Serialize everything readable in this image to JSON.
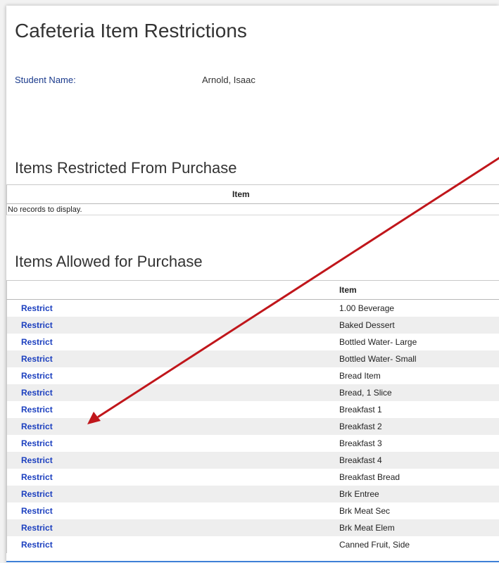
{
  "page": {
    "title": "Cafeteria Item Restrictions",
    "student_label": "Student Name:",
    "student_name": "Arnold, Isaac"
  },
  "restricted_section": {
    "title": "Items Restricted From Purchase",
    "column_item": "Item",
    "empty_message": "No records to display."
  },
  "allowed_section": {
    "title": "Items Allowed for Purchase",
    "column_item": "Item",
    "action_label": "Restrict",
    "rows": [
      "1.00 Beverage",
      "Baked Dessert",
      "Bottled Water- Large",
      "Bottled Water- Small",
      "Bread Item",
      "Bread, 1 Slice",
      "Breakfast 1",
      "Breakfast 2",
      "Breakfast 3",
      "Breakfast 4",
      "Breakfast Bread",
      "Brk Entree",
      "Brk Meat Sec",
      "Brk Meat Elem",
      "Canned Fruit, Side"
    ]
  },
  "colors": {
    "link": "#1b3fbf",
    "annotation_arrow": "#c0161b",
    "stripe": "#eeeeee"
  }
}
